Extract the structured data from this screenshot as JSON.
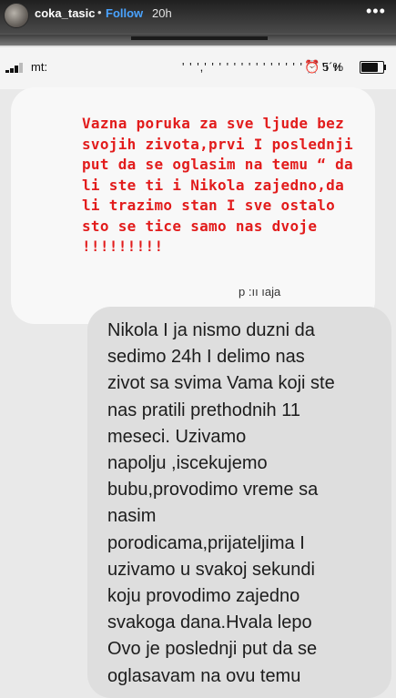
{
  "story": {
    "username": "coka_tasic",
    "separator": "•",
    "follow_label": "Follow",
    "time_ago": "20h",
    "more_glyph": "•••"
  },
  "status_bar": {
    "carrier": "mt:",
    "clock": "' ' ',' ' ' ' ' ' ' ' ' '  ' ' ' ' ' ' 'ı ıı",
    "alarm_glyph": "⏰",
    "battery_percent": "5´%",
    "battery_level": 0.8,
    "signal_bars_filled": 3
  },
  "headline": "Vazna poruka za sve ljude bez svojih zivota,prvi I poslednji put da se oglasim na temu “ da li ste ti i Nikola zajedno,da li trazimo stan I sve ostalo sto se tice samo nas dvoje !!!!!!!!!",
  "residual_text": "p :ıı ıaja",
  "body": "Nikola I ja nismo duzni da\nsedimo 24h I delimo nas\nzivot sa svima Vama koji ste\nnas pratili prethodnih 11\nmeseci. Uzivamo\nnapolju ,iscekujemo\nbubu,provodimo vreme sa\nnasim\nporodicama,prijateljima I\nuzivamo u svakoj sekundi\nkoju provodimo zajedno\nsvakoga dana.Hvala lepo\nOvo je poslednji put da se\noglasavam na ovu temu",
  "colors": {
    "follow": "#4aa3ff",
    "headline": "#e21c1c",
    "bubble": "#dedede"
  }
}
